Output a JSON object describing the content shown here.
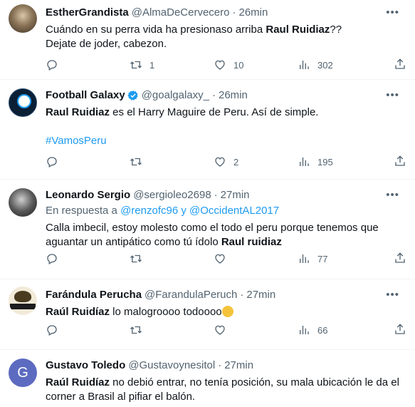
{
  "tweets": [
    {
      "name": "EstherGrandista",
      "handle": "@AlmaDeCervecero",
      "time": "26min",
      "line1_a": "Cuándo en su perra vida ha presionaso arriba ",
      "line1_b": "Raul Ruidiaz",
      "line1_c": "??",
      "line2": "Dejate de joder, cabezon.",
      "retweets": "1",
      "likes": "10",
      "views": "302"
    },
    {
      "name": "Football Galaxy",
      "handle": "@goalgalaxy_",
      "time": "26min",
      "line1_a": "Raul Ruidiaz",
      "line1_b": " es el Harry Maguire de Peru. Así de simple.",
      "hashtag": "#VamosPeru",
      "retweets": "",
      "likes": "2",
      "views": "195"
    },
    {
      "name": "Leonardo Sergio",
      "handle": "@sergioleo2698",
      "time": "27min",
      "reply_prefix": "En respuesta a ",
      "reply_users": "@renzofc96 y @OccidentAL2017",
      "line1": "Calla imbecil, estoy molesto como el todo el peru porque tenemos que",
      "line2_a": "aguantar un antipático como tú ídolo ",
      "line2_b": "Raul ruidiaz",
      "views": "77"
    },
    {
      "name": "Farándula Perucha",
      "handle": "@FarandulaPeruch",
      "time": "27min",
      "line1_a": "Raúl Ruidíaz",
      "line1_b": " lo malogroooo todoooo",
      "views": "66"
    },
    {
      "name": "Gustavo Toledo",
      "handle": "@Gustavoynesitol",
      "time": "27min",
      "avatar_letter": "G",
      "line1_a": "Raúl Ruidíaz",
      "line1_b": " no debió entrar, no tenía posición, su mala ubicación le da el",
      "line2": "corner a Brasil al pifiar el balón."
    }
  ],
  "separator": "·",
  "colors": {
    "accent": "#1d9bf0",
    "muted": "#536471",
    "text": "#0f1419"
  },
  "icons": [
    "reply-icon",
    "retweet-icon",
    "like-icon",
    "views-icon",
    "share-icon",
    "more-icon",
    "verified-icon"
  ]
}
